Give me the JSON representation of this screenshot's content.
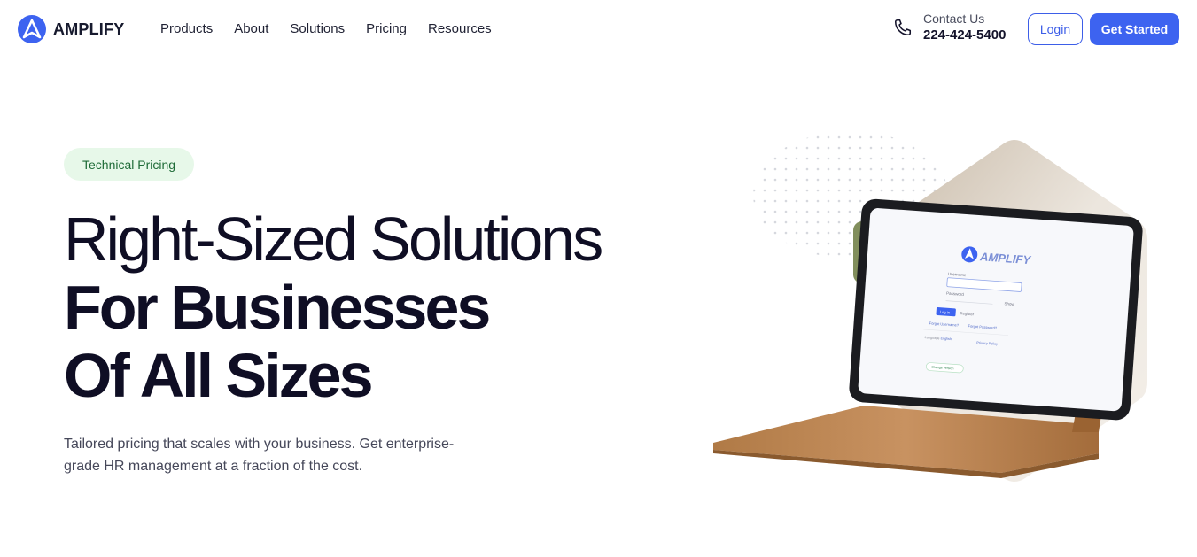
{
  "brand": {
    "name": "AMPLIFY"
  },
  "nav": {
    "items": [
      "Products",
      "About",
      "Solutions",
      "Pricing",
      "Resources"
    ]
  },
  "contact": {
    "label": "Contact Us",
    "phone": "224-424-5400"
  },
  "actions": {
    "login": "Login",
    "get_started": "Get Started"
  },
  "hero": {
    "badge": "Technical Pricing",
    "headline": [
      "Right-Sized Solutions",
      "For Businesses",
      "Of All Sizes"
    ],
    "subtext": "Tailored pricing that scales with your business. Get enterprise-grade HR management at a fraction of the cost."
  },
  "tablet_screen": {
    "brand": "AMPLIFY",
    "username_label": "Username",
    "password_label": "Password",
    "show_label": "Show",
    "login_button": "Log in",
    "register_link": "Register",
    "forgot_username": "Forgot Username?",
    "forgot_password": "Forgot Password?",
    "language_label": "Language",
    "language_value": "English",
    "privacy_link": "Privacy Policy",
    "change_version": "Change version"
  },
  "colors": {
    "accent": "#3d63f0",
    "badge_bg": "#e7f8e9",
    "badge_text": "#1e6b37",
    "text": "#0f0e24"
  }
}
